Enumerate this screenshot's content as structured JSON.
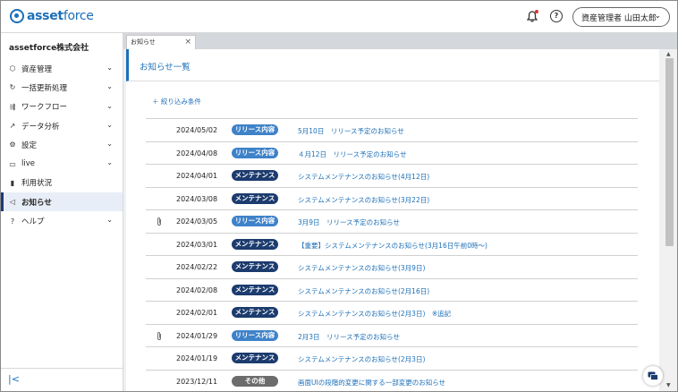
{
  "header": {
    "logo_bold": "asset",
    "logo_thin": "force",
    "user_label": "資産管理者 山田太郎"
  },
  "sidebar": {
    "company": "assetforce株式会社",
    "items": [
      {
        "label": "資産管理",
        "icon": "cube-icon",
        "expandable": true,
        "active": false
      },
      {
        "label": "一括更新処理",
        "icon": "refresh-icon",
        "expandable": true,
        "active": false
      },
      {
        "label": "ワークフロー",
        "icon": "workflow-icon",
        "expandable": true,
        "active": false
      },
      {
        "label": "データ分析",
        "icon": "analytics-icon",
        "expandable": true,
        "active": false
      },
      {
        "label": "設定",
        "icon": "gear-icon",
        "expandable": true,
        "active": false
      },
      {
        "label": "live",
        "icon": "chat-icon",
        "expandable": true,
        "active": false
      },
      {
        "label": "利用状況",
        "icon": "bar-chart-icon",
        "expandable": false,
        "active": false
      },
      {
        "label": "お知らせ",
        "icon": "megaphone-icon",
        "expandable": false,
        "active": true
      },
      {
        "label": "ヘルプ",
        "icon": "help-icon",
        "expandable": true,
        "active": false
      }
    ]
  },
  "tabs": [
    {
      "label": "お知らせ"
    }
  ],
  "main": {
    "page_title": "お知らせ一覧",
    "filter_label": "＋ 絞り込み条件"
  },
  "notices": [
    {
      "date": "2024/05/02",
      "badge": "リリース内容",
      "type": "release",
      "title": "5月10日　リリース予定のお知らせ",
      "attachment": false
    },
    {
      "date": "2024/04/08",
      "badge": "リリース内容",
      "type": "release",
      "title": "４月12日　リリース予定のお知らせ",
      "attachment": false
    },
    {
      "date": "2024/04/01",
      "badge": "メンテナンス",
      "type": "maint",
      "title": "システムメンテナンスのお知らせ(4月12日)",
      "attachment": false
    },
    {
      "date": "2024/03/08",
      "badge": "メンテナンス",
      "type": "maint",
      "title": "システムメンテナンスのお知らせ(3月22日)",
      "attachment": false
    },
    {
      "date": "2024/03/05",
      "badge": "リリース内容",
      "type": "release",
      "title": "3月9日　リリース予定のお知らせ",
      "attachment": true
    },
    {
      "date": "2024/03/01",
      "badge": "メンテナンス",
      "type": "maint",
      "title": "【重要】システムメンテナンスのお知らせ(3月16日午前0時〜)",
      "attachment": false
    },
    {
      "date": "2024/02/22",
      "badge": "メンテナンス",
      "type": "maint",
      "title": "システムメンテナンスのお知らせ(3月9日)",
      "attachment": false
    },
    {
      "date": "2024/02/08",
      "badge": "メンテナンス",
      "type": "maint",
      "title": "システムメンテナンスのお知らせ(2月16日)",
      "attachment": false
    },
    {
      "date": "2024/02/01",
      "badge": "メンテナンス",
      "type": "maint",
      "title": "システムメンテナンスのお知らせ(2月3日)　※追記",
      "attachment": false
    },
    {
      "date": "2024/01/29",
      "badge": "リリース内容",
      "type": "release",
      "title": "2月3日　リリース予定のお知らせ",
      "attachment": true
    },
    {
      "date": "2024/01/19",
      "badge": "メンテナンス",
      "type": "maint",
      "title": "システムメンテナンスのお知らせ(2月3日)",
      "attachment": false
    },
    {
      "date": "2023/12/11",
      "badge": "その他",
      "type": "other",
      "title": "画面UIの段階的変更に関する一部変更のお知らせ",
      "attachment": false
    }
  ]
}
